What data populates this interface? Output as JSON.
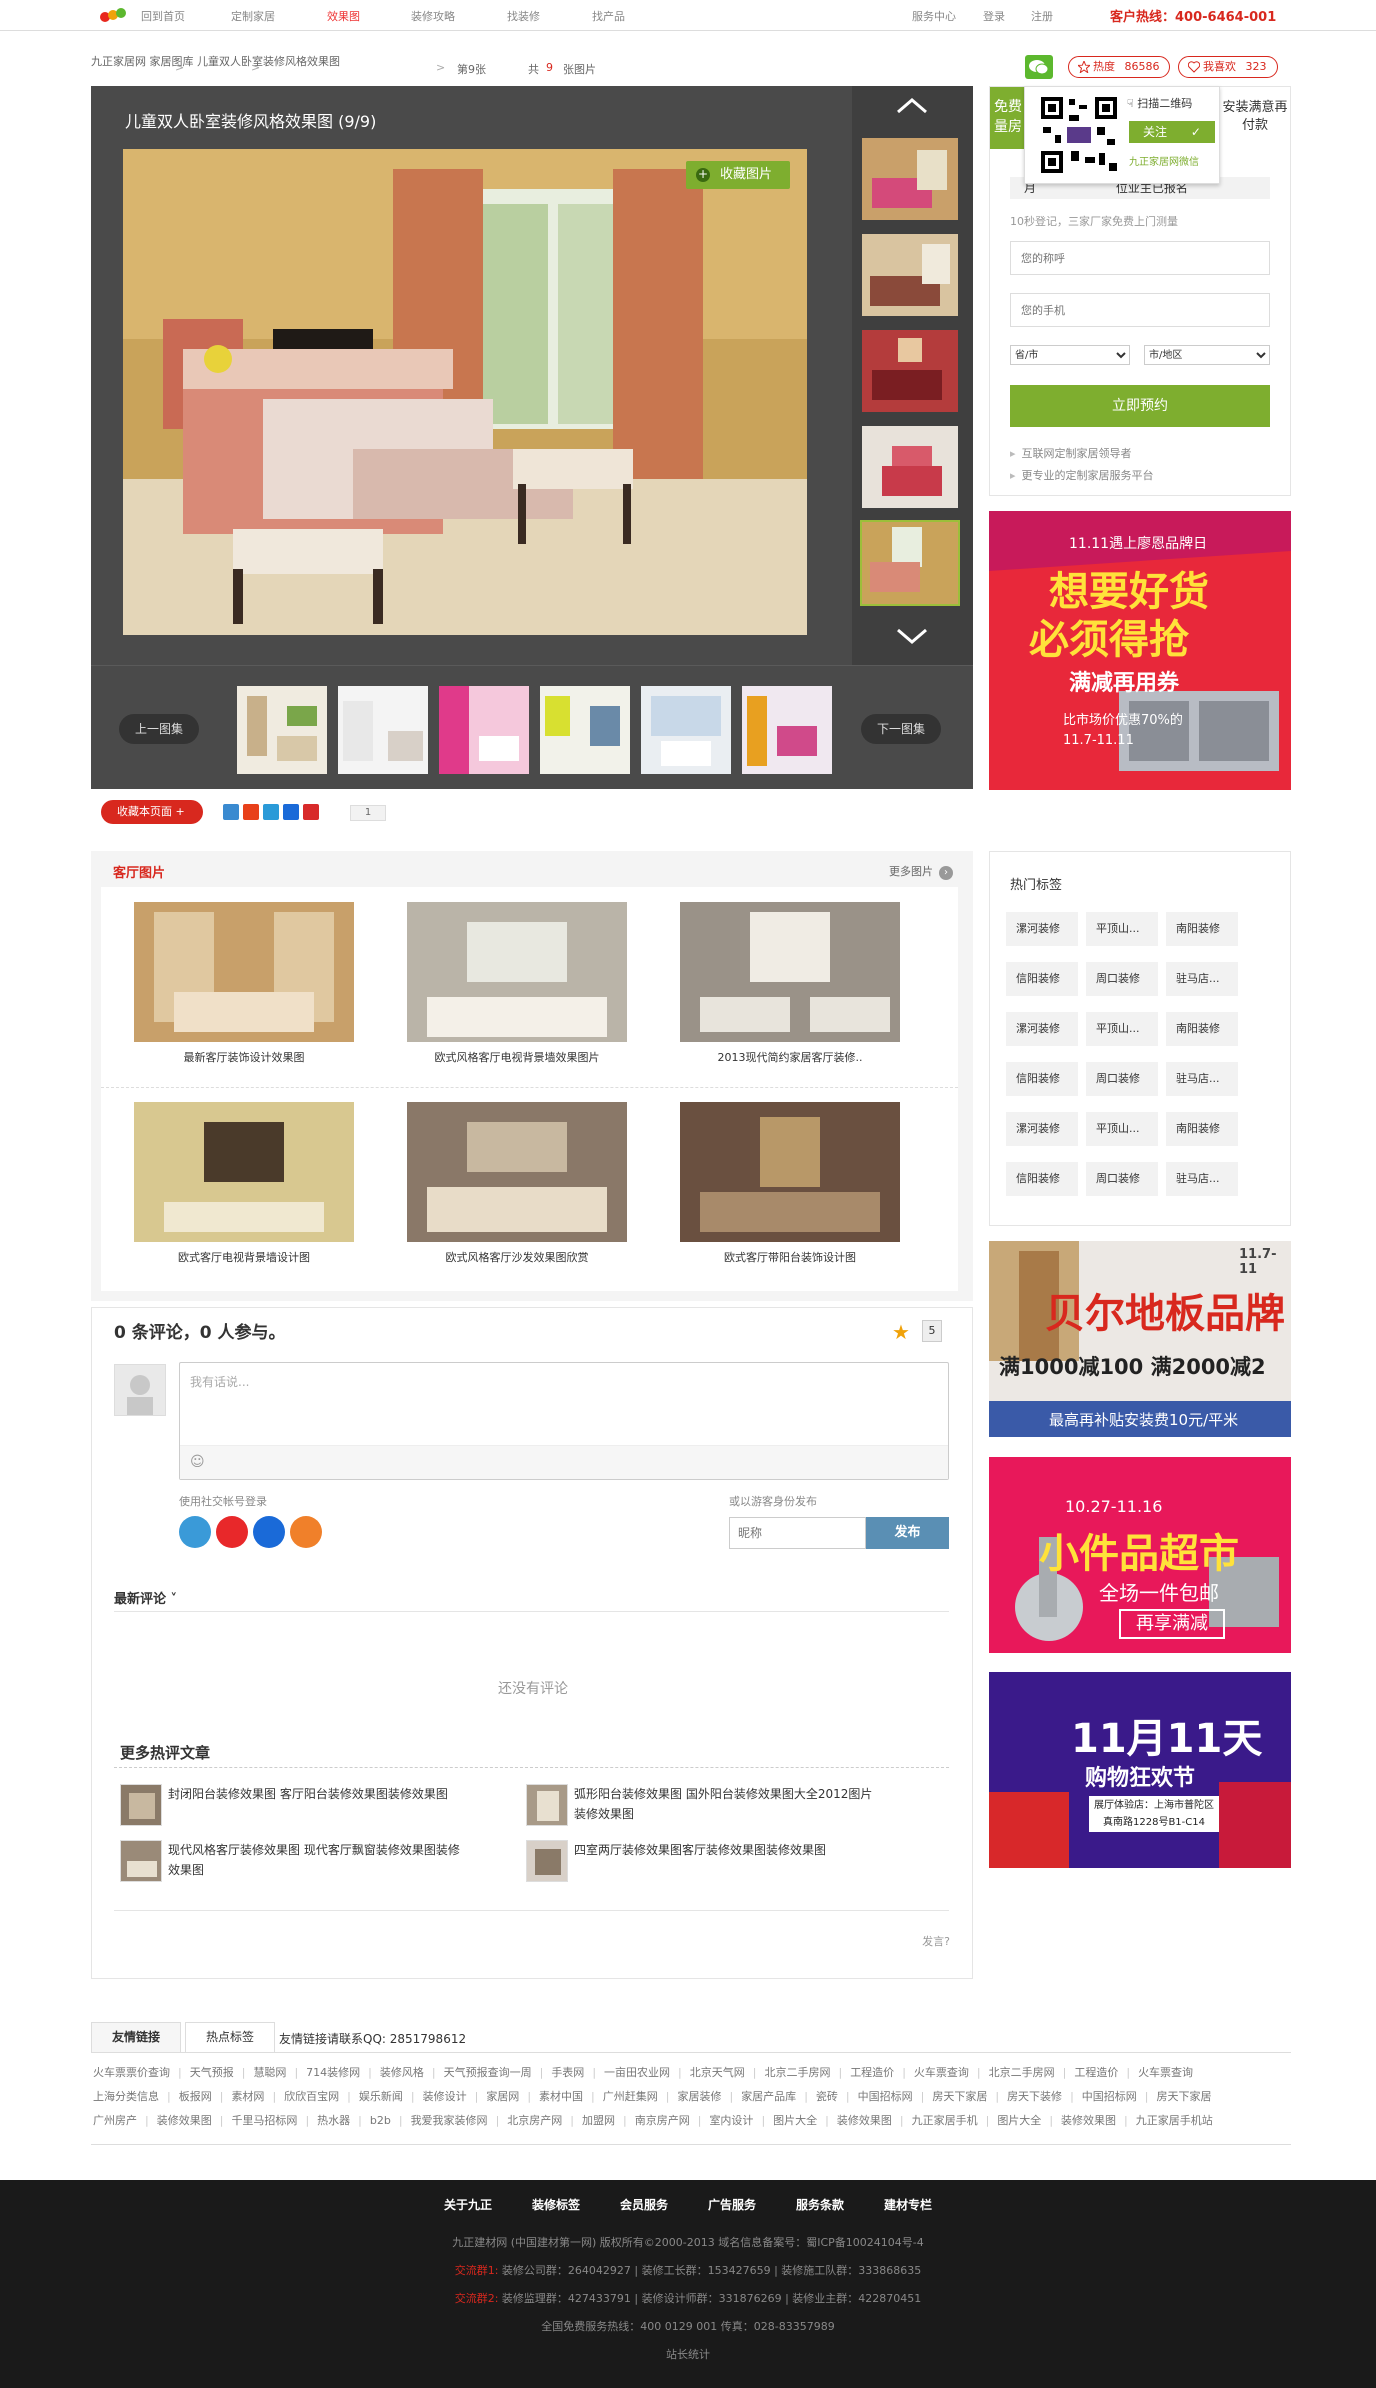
{
  "topnav": {
    "items": [
      "回到首页",
      "定制家居",
      "效果图",
      "装修攻略",
      "找装修",
      "找产品"
    ],
    "right": [
      "服务中心",
      "登录",
      "注册"
    ],
    "hotline": "客户热线：400-6464-001"
  },
  "breadcrumb": {
    "items": [
      "九正家居网",
      "家居图库",
      "儿童双人卧室装修风格效果图",
      "第9张"
    ],
    "total_prefix": "共",
    "total": "9",
    "total_suffix": "张图片"
  },
  "actions": {
    "heat_label": "热度",
    "heat_value": "86586",
    "like_label": "我喜欢",
    "like_value": "323"
  },
  "viewer": {
    "title": "儿童双人卧室装修风格效果图 (9/9)",
    "collect_label": "收藏图片",
    "prev_label": "上一图集",
    "next_label": "下一图集"
  },
  "share": {
    "fav_label": "收藏本页面 +",
    "count": "1"
  },
  "quote": {
    "tab_free": "免费量房",
    "tab_pay": "安装满意再付款",
    "promo_prefix": "月",
    "promo_suffix": "位业主已报名",
    "desc": "10秒登记，三家厂家免费上门测量",
    "name_placeholder": "您的称呼",
    "phone_placeholder": "您的手机",
    "province": "省/市",
    "city": "市/地区",
    "apply_label": "立即预约",
    "bullet1": "互联网定制家居领导者",
    "bullet2": "更专业的定制家居服务平台"
  },
  "qr_popup": {
    "scan_label": "扫描二维码",
    "follow_label": "关注",
    "account": "九正家居网微信"
  },
  "ads": {
    "ad1_top": "11.11遇上廖恩品牌日",
    "ad1_l1": "想要好货",
    "ad1_l2": "必须得抢",
    "ad1_l3": "满减再用券",
    "ad1_l4": "比市场价优惠70%的",
    "ad1_date": "11.7-11.11",
    "ad2_date": "11.7-11",
    "ad2_brand": "贝尔地板品牌",
    "ad2_l2": "满1000减100 满2000减2",
    "ad2_l3": "最高再补贴安装费10元/平米",
    "ad3_date": "10.27-11.16",
    "ad3_l1": "小件品超市",
    "ad3_l2": "全场一件包邮",
    "ad3_l3": "再享满减",
    "ad4_l1": "11月11天",
    "ad4_l2": "购物狂欢节",
    "ad4_l3": "展厅体验店：上海市普陀区",
    "ad4_l4": "真南路1228号B1-C14"
  },
  "living": {
    "title": "客厅图片",
    "more": "更多图片",
    "items": [
      "最新客厅装饰设计效果图",
      "欧式风格客厅电视背景墙效果图片",
      "2013现代简约家居客厅装修..",
      "欧式客厅电视背景墙设计图",
      "欧式风格客厅沙发效果图欣赏",
      "欧式客厅带阳台装饰设计图"
    ]
  },
  "tags": {
    "title": "热门标签",
    "items": [
      "漯河装修",
      "平顶山...",
      "南阳装修",
      "信阳装修",
      "周口装修",
      "驻马店...",
      "漯河装修",
      "平顶山...",
      "南阳装修",
      "信阳装修",
      "周口装修",
      "驻马店...",
      "漯河装修",
      "平顶山...",
      "南阳装修",
      "信阳装修",
      "周口装修",
      "驻马店..."
    ]
  },
  "comments": {
    "head": "0 条评论，0 人参与。",
    "count": "5",
    "placeholder": "我有话说...",
    "social_label": "使用社交帐号登录",
    "anon_label": "或以游客身份发布",
    "nick_placeholder": "昵称",
    "publish": "发布",
    "latest": "最新评论 ˅",
    "empty": "还没有评论",
    "hot_title": "更多热评文章",
    "articles": [
      "封闭阳台装修效果图 客厅阳台装修效果图装修效果图",
      "弧形阳台装修效果图 国外阳台装修效果图大全2012图片装修效果图",
      "现代风格客厅装修效果图 现代客厅飘窗装修效果图装修效果图",
      "四室两厅装修效果图客厅装修效果图装修效果图"
    ],
    "footer": "发言?"
  },
  "links": {
    "tab1": "友情链接",
    "tab2": "热点标签",
    "contact": "友情链接请联系QQ: 2851798612",
    "row1": [
      "火车票票价查询",
      "天气预报",
      "慧聪网",
      "714装修网",
      "装修风格",
      "天气预报查询一周",
      "手表网",
      "一亩田农业网",
      "北京天气网",
      "北京二手房网",
      "工程造价",
      "火车票查询",
      "北京二手房网",
      "工程造价",
      "火车票查询"
    ],
    "row2": [
      "上海分类信息",
      "板报网",
      "素材网",
      "欣欣百宝网",
      "娱乐新闻",
      "装修设计",
      "家居网",
      "素材中国",
      "广州赶集网",
      "家居装修",
      "家居产品库",
      "瓷砖",
      "中国招标网",
      "房天下家居",
      "房天下装修",
      "中国招标网",
      "房天下家居"
    ],
    "row3": [
      "广州房产",
      "装修效果图",
      "千里马招标网",
      "热水器",
      "b2b",
      "我爱我家装修网",
      "北京房产网",
      "加盟网",
      "南京房产网",
      "室内设计",
      "图片大全",
      "装修效果图",
      "九正家居手机",
      "图片大全",
      "装修效果图",
      "九正家居手机站"
    ]
  },
  "footer": {
    "nav": [
      "关于九正",
      "装修标签",
      "会员服务",
      "广告服务",
      "服务条款",
      "建材专栏"
    ],
    "copyright": "九正建材网 (中国建材第一网) 版权所有©2000-2013   域名信息备案号：蜀ICP备10024104号-4",
    "group1_label": "交流群1:",
    "group1": "装修公司群：264042927 | 装修工长群：153427659 | 装修施工队群：333868635",
    "group2_label": "交流群2:",
    "group2": "装修监理群：427433791 | 装修设计师群：331876269 | 装修业主群：422870451",
    "hotline": "全国免费服务热线：400 0129 001 传真：028-83357989",
    "stats": "站长统计"
  }
}
